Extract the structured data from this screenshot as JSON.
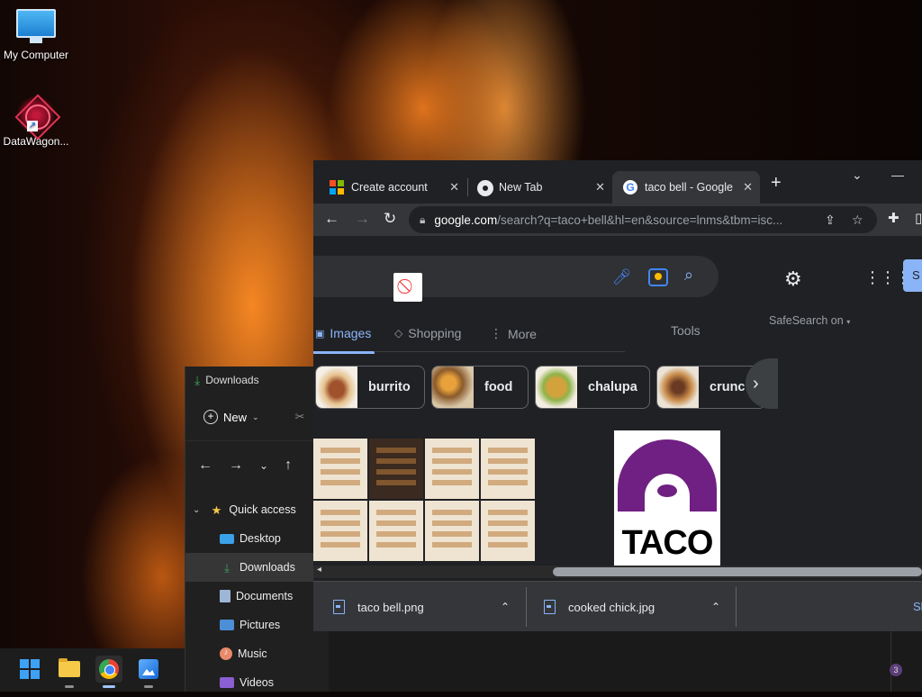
{
  "desktop": {
    "icons": [
      {
        "label": "My Computer",
        "icon": "monitor-icon"
      },
      {
        "label": "DataWagon...",
        "icon": "datawagon-icon"
      }
    ]
  },
  "explorer": {
    "title": "Downloads",
    "new_label": "New",
    "tree": [
      {
        "label": "Quick access",
        "icon": "star-icon"
      },
      {
        "label": "Desktop",
        "icon": "desktop-folder-icon"
      },
      {
        "label": "Downloads",
        "icon": "download-icon",
        "selected": true
      },
      {
        "label": "Documents",
        "icon": "documents-icon"
      },
      {
        "label": "Pictures",
        "icon": "pictures-icon"
      },
      {
        "label": "Music",
        "icon": "music-icon"
      },
      {
        "label": "Videos",
        "icon": "videos-icon"
      }
    ]
  },
  "browser": {
    "tabs": [
      {
        "title": "Create account"
      },
      {
        "title": "New Tab"
      },
      {
        "title": "taco bell - Google",
        "active": true
      }
    ],
    "url": {
      "host": "google.com",
      "rest": "/search?q=taco+bell&hl=en&source=lnms&tbm=isc..."
    },
    "search_nav": {
      "images": "Images",
      "shopping": "Shopping",
      "more": "More",
      "tools": "Tools",
      "safesearch": "SafeSearch on"
    },
    "signin_letter": "S",
    "chips": [
      {
        "label": "burrito"
      },
      {
        "label": "food"
      },
      {
        "label": "chalupa"
      },
      {
        "label": "crunc"
      }
    ],
    "logo_text": "TACO",
    "downloads": [
      {
        "filename": "taco bell.png"
      },
      {
        "filename": "cooked chick.jpg"
      }
    ],
    "show_all": "Sh"
  },
  "taskbar": {
    "apps": [
      "start-icon",
      "file-explorer-icon",
      "chrome-icon",
      "photos-icon"
    ],
    "notification_count": "3"
  },
  "colors": {
    "chrome_bg": "#202124",
    "chrome_toolbar": "#35363a",
    "accent_blue": "#8ab4f8",
    "taco_purple": "#702082"
  }
}
